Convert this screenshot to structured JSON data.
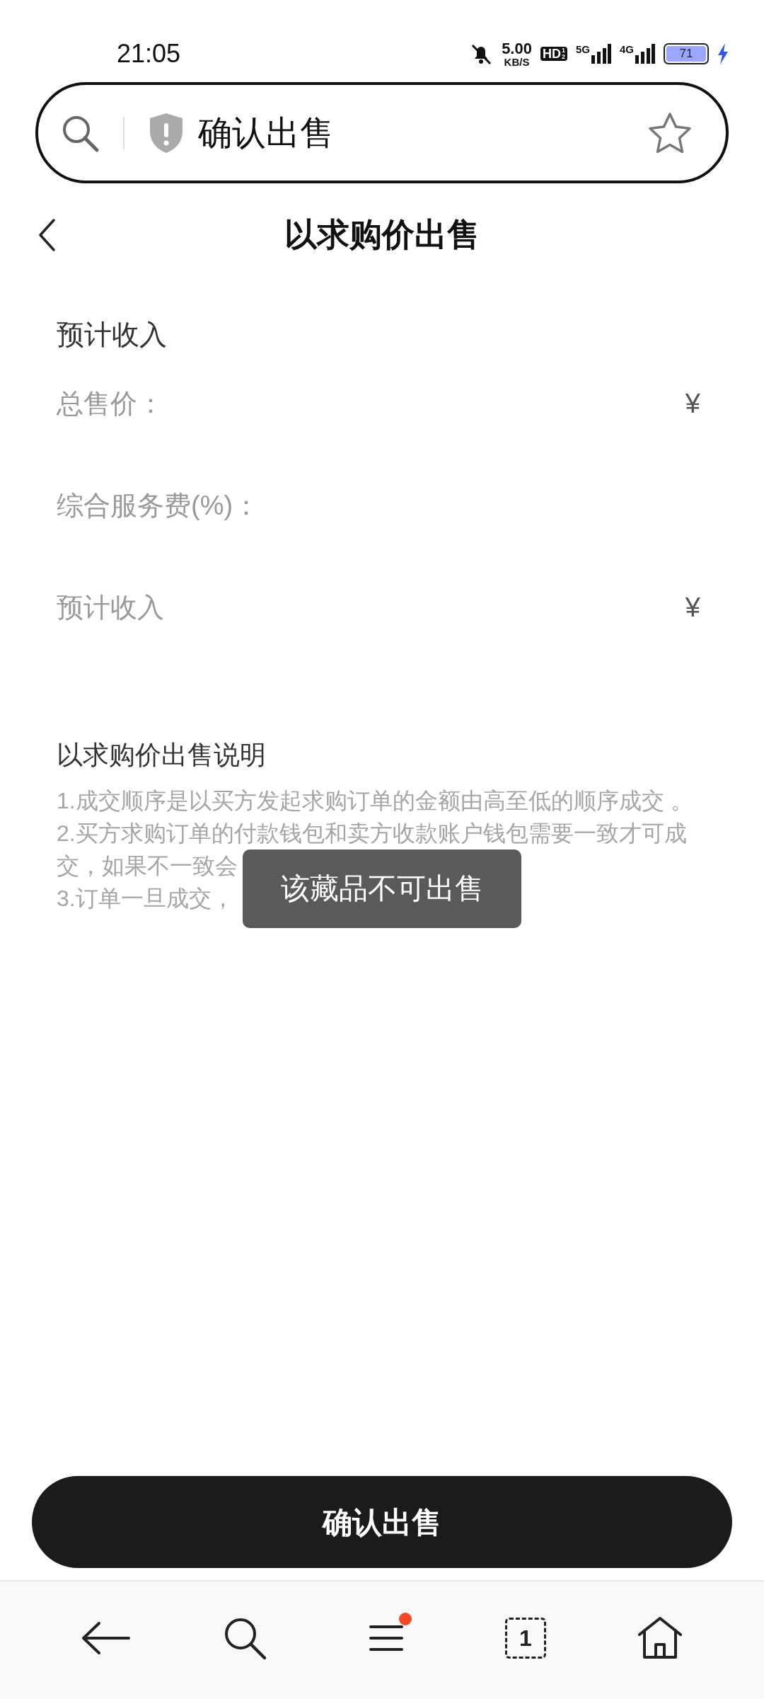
{
  "status_bar": {
    "time": "21:05",
    "speed": "5.00",
    "speed_unit": "KB/S",
    "hd": "HD",
    "hd_sims": [
      "1",
      "2"
    ],
    "networks": [
      "5G",
      "4G"
    ],
    "battery": "71",
    "charging": true
  },
  "address_bar": {
    "title": "确认出售"
  },
  "header": {
    "title": "以求购价出售"
  },
  "income": {
    "heading": "预计收入",
    "rows": [
      {
        "label": "总售价：",
        "value": "¥"
      },
      {
        "label": "综合服务费(%)："
      },
      {
        "label": "预计收入",
        "value": "¥"
      }
    ]
  },
  "notes": {
    "heading": "以求购价出售说明",
    "lines": [
      "1.成交顺序是以买方发起求购订单的金额由高至低的顺序成交 。",
      "2.买方求购订单的付款钱包和卖方收款账户钱包需要一致才可成交，如果不一致会",
      "3.订单一旦成交，"
    ]
  },
  "toast": {
    "text": "该藏品不可出售"
  },
  "confirm_button": {
    "label": "确认出售"
  },
  "bottom_nav": {
    "tabs_count": "1",
    "menu_badge": true
  }
}
